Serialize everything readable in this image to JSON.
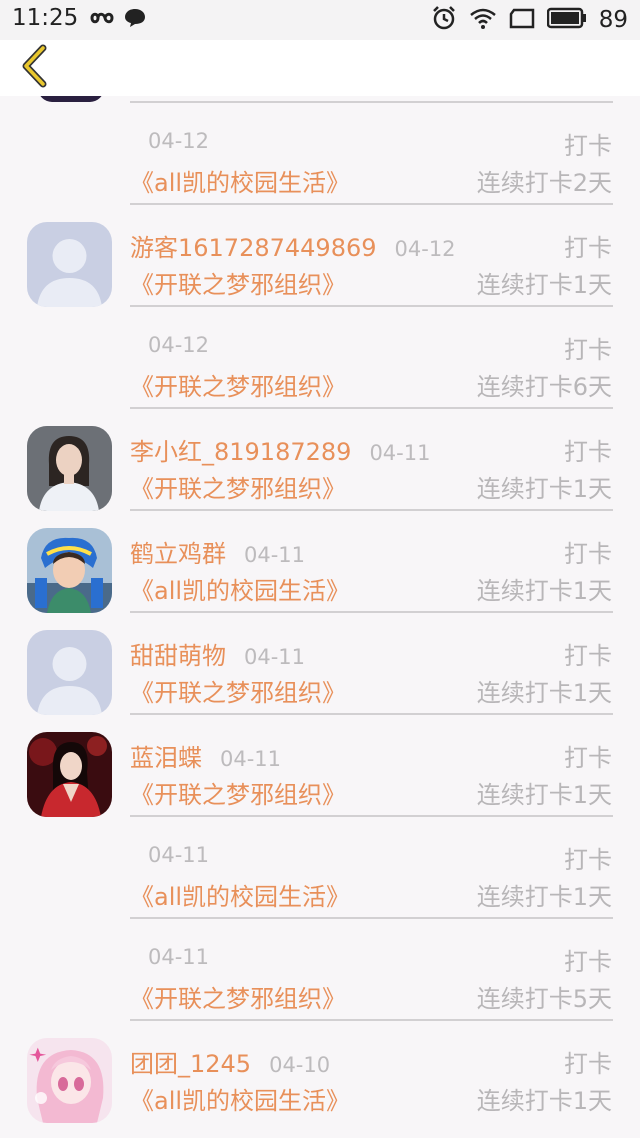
{
  "status_bar": {
    "time": "11:25",
    "battery": "89",
    "left_icons": [
      "infinity-icon",
      "chat-bubble-icon"
    ],
    "right_icons": [
      "alarm-icon",
      "wifi-icon",
      "window-icon",
      "battery-icon"
    ]
  },
  "header": {
    "back_icon": "chevron-left-icon",
    "accent": "#e9c72e"
  },
  "colors": {
    "name": "#e8905a",
    "muted": "#b8b6b8",
    "background": "#f8f6f8"
  },
  "entries": [
    {
      "name": "",
      "date": "04-12",
      "action": "打卡",
      "group": "《all凯的校园生活》",
      "streak": "连续打卡2天",
      "avatar": "none"
    },
    {
      "name": "游客1617287449869",
      "date": "04-12",
      "action": "打卡",
      "group": "《开联之梦邪组织》",
      "streak": "连续打卡1天",
      "avatar": "default-user-avatar"
    },
    {
      "name": "",
      "date": "04-12",
      "action": "打卡",
      "group": "《开联之梦邪组织》",
      "streak": "连续打卡6天",
      "avatar": "none"
    },
    {
      "name": "李小红_819187289",
      "date": "04-11",
      "action": "打卡",
      "group": "《开联之梦邪组织》",
      "streak": "连续打卡1天",
      "avatar": "photo-woman-white-dress"
    },
    {
      "name": "鹤立鸡群",
      "date": "04-11",
      "action": "打卡",
      "group": "《all凯的校园生活》",
      "streak": "连续打卡1天",
      "avatar": "photo-child-blue-headband"
    },
    {
      "name": "甜甜萌物",
      "date": "04-11",
      "action": "打卡",
      "group": "《开联之梦邪组织》",
      "streak": "连续打卡1天",
      "avatar": "default-user-avatar"
    },
    {
      "name": "蓝泪蝶",
      "date": "04-11",
      "action": "打卡",
      "group": "《开联之梦邪组织》",
      "streak": "连续打卡1天",
      "avatar": "photo-woman-red-costume"
    },
    {
      "name": "",
      "date": "04-11",
      "action": "打卡",
      "group": "《all凯的校园生活》",
      "streak": "连续打卡1天",
      "avatar": "none"
    },
    {
      "name": "",
      "date": "04-11",
      "action": "打卡",
      "group": "《开联之梦邪组织》",
      "streak": "连续打卡5天",
      "avatar": "none"
    },
    {
      "name": "团团_1245",
      "date": "04-10",
      "action": "打卡",
      "group": "《all凯的校园生活》",
      "streak": "连续打卡1天",
      "avatar": "anime-pink-girl"
    }
  ]
}
